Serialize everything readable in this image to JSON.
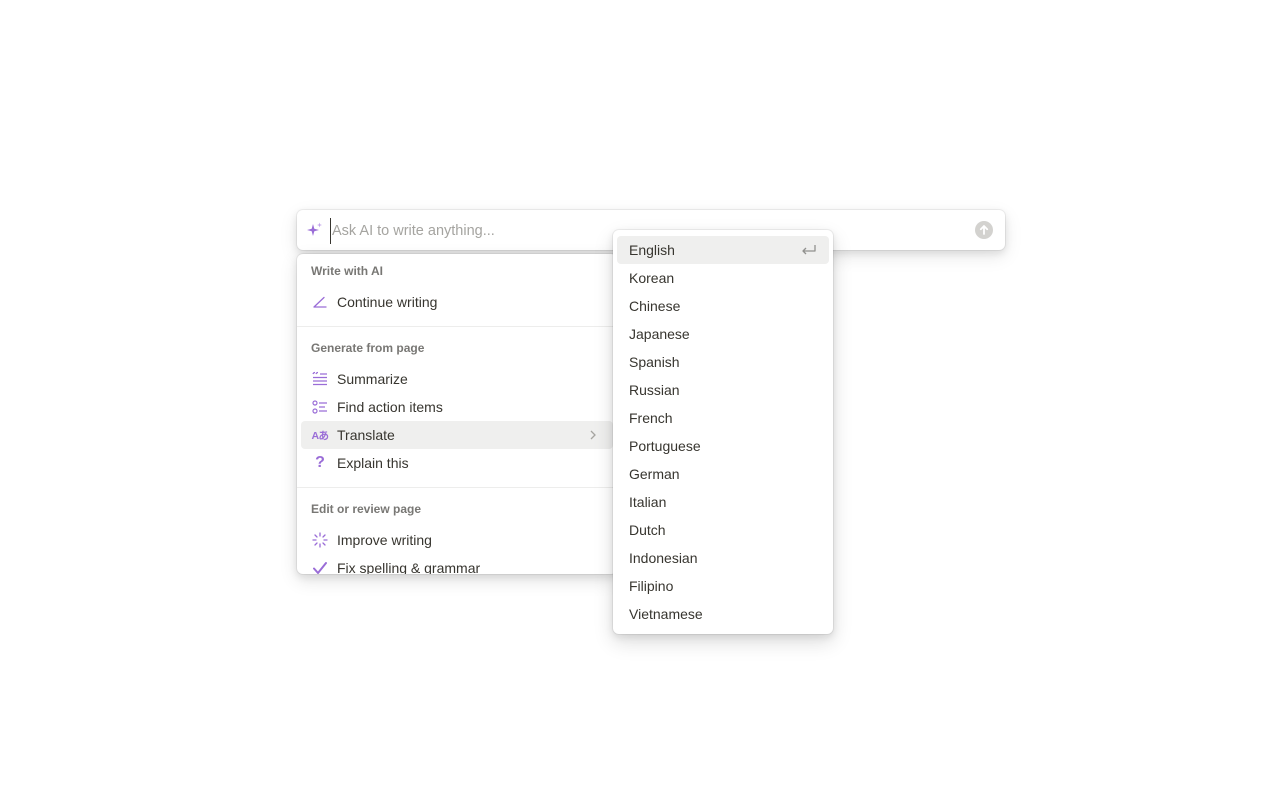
{
  "ai_bar": {
    "placeholder": "Ask AI to write anything..."
  },
  "menu": {
    "sections": [
      {
        "title": "Write with AI",
        "items": [
          {
            "label": "Continue writing",
            "icon": "pen-icon"
          }
        ]
      },
      {
        "title": "Generate from page",
        "items": [
          {
            "label": "Summarize",
            "icon": "summarize-icon"
          },
          {
            "label": "Find action items",
            "icon": "checklist-icon"
          },
          {
            "label": "Translate",
            "icon": "translate-icon"
          },
          {
            "label": "Explain this",
            "icon": "question-icon"
          }
        ]
      },
      {
        "title": "Edit or review page",
        "items": [
          {
            "label": "Improve writing",
            "icon": "sparkle-burst-icon"
          },
          {
            "label": "Fix spelling & grammar",
            "icon": "checkmark-icon"
          }
        ]
      }
    ],
    "translate_glyph": "Aあ"
  },
  "languages": [
    "English",
    "Korean",
    "Chinese",
    "Japanese",
    "Spanish",
    "Russian",
    "French",
    "Portuguese",
    "German",
    "Italian",
    "Dutch",
    "Indonesian",
    "Filipino",
    "Vietnamese"
  ],
  "colors": {
    "accent": "#9a6dd7",
    "hover": "#efefee",
    "text": "#37352f",
    "muted": "#787774"
  }
}
